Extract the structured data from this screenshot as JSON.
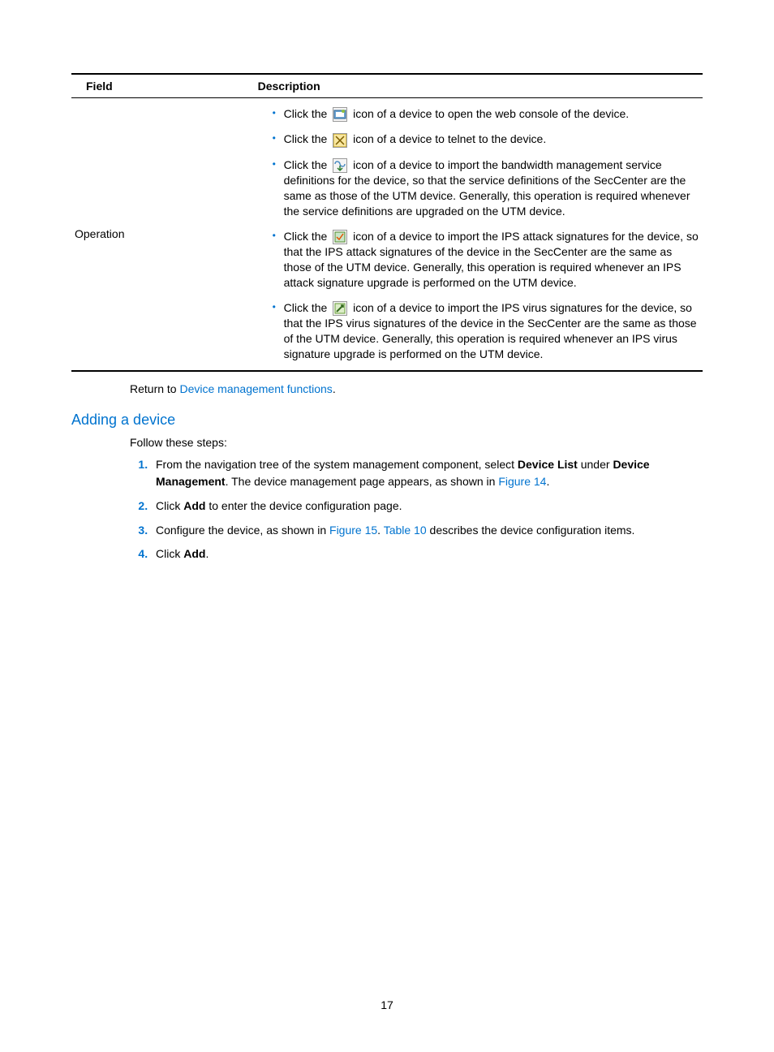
{
  "table": {
    "headers": {
      "field": "Field",
      "description": "Description"
    },
    "row": {
      "field": "Operation",
      "items": [
        {
          "pre": "Click the ",
          "icon": "web-console-icon",
          "post": " icon of a device to open the web console of the device."
        },
        {
          "pre": "Click the ",
          "icon": "telnet-icon",
          "post": " icon of a device to telnet to the device."
        },
        {
          "pre": "Click the ",
          "icon": "import-bandwidth-icon",
          "post": " icon of a device to import the bandwidth management service definitions for the device, so that the service definitions of the SecCenter are the same as those of the UTM device. Generally, this operation is required whenever the service definitions are upgraded on the UTM device."
        },
        {
          "pre": "Click the ",
          "icon": "import-ips-attack-icon",
          "post": " icon of a device to import the IPS attack signatures for the device, so that the IPS attack signatures of the device in the SecCenter are the same as those of the UTM device. Generally, this operation is required whenever an IPS attack signature upgrade is performed on the UTM device."
        },
        {
          "pre": "Click the ",
          "icon": "import-ips-virus-icon",
          "post": " icon of a device to import the IPS virus signatures for the device, so that the IPS virus signatures of the device in the SecCenter are the same as those of the UTM device. Generally, this operation is required whenever an IPS virus signature upgrade is performed on the UTM device."
        }
      ]
    }
  },
  "return_to": {
    "prefix": "Return to ",
    "link": "Device management functions",
    "suffix": "."
  },
  "section_heading": "Adding a device",
  "intro_line": "Follow these steps:",
  "steps": {
    "s1": {
      "t1": "From the navigation tree of the system management component, select ",
      "b1": "Device List",
      "t2": " under ",
      "b2": "Device Management",
      "t3": ". The device management page appears, as shown in ",
      "link1": "Figure 14",
      "t4": "."
    },
    "s2": {
      "t1": "Click ",
      "b1": "Add",
      "t2": " to enter the device configuration page."
    },
    "s3": {
      "t1": "Configure the device, as shown in ",
      "link1": "Figure 15",
      "t2": ". ",
      "link2": "Table 10",
      "t3": " describes the device configuration items."
    },
    "s4": {
      "t1": "Click ",
      "b1": "Add",
      "t2": "."
    }
  },
  "page_number": "17",
  "icon_svgs": {
    "web-console-icon": "<svg width='16' height='16'><rect x='1' y='3' width='14' height='10' fill='#6fa8d8' stroke='#2a5f8f'/><rect x='3' y='5' width='10' height='6' fill='#fff'/><circle cx='12' cy='4' r='2' fill='#8fbf3f'/></svg>",
    "telnet-icon": "<svg width='16' height='16'><rect x='0' y='0' width='16' height='16' fill='#f9e79f' stroke='#b7950b'/><path d='M3 3 L8 8 L3 13 M8 8 L13 3 M8 8 L13 13' stroke='#7a5c00' stroke-width='1.5' fill='none'/></svg>",
    "import-bandwidth-icon": "<svg width='16' height='16'><path d='M2 6 C2 2 7 2 8 6 C9 10 14 10 14 6' stroke='#4a8bc2' stroke-width='1.5' fill='none'/><path d='M8 14 L8 8 M5 11 L8 14 L11 11' stroke='#2e7d32' stroke-width='1.5' fill='none'/></svg>",
    "import-ips-attack-icon": "<svg width='16' height='16'><rect x='2' y='2' width='12' height='12' fill='#c8e6c9' stroke='#558b2f'/><path d='M4 8 L7 11 L12 4' stroke='#e65100' stroke-width='1.5' fill='none'/></svg>",
    "import-ips-virus-icon": "<svg width='16' height='16'><rect x='2' y='2' width='12' height='12' fill='#dcedc8' stroke='#689f38'/><path d='M4 12 L12 4' stroke='#33691e' stroke-width='2'/><path d='M9 4 L12 4 L12 7' stroke='#33691e' stroke-width='1.5' fill='none'/></svg>"
  }
}
